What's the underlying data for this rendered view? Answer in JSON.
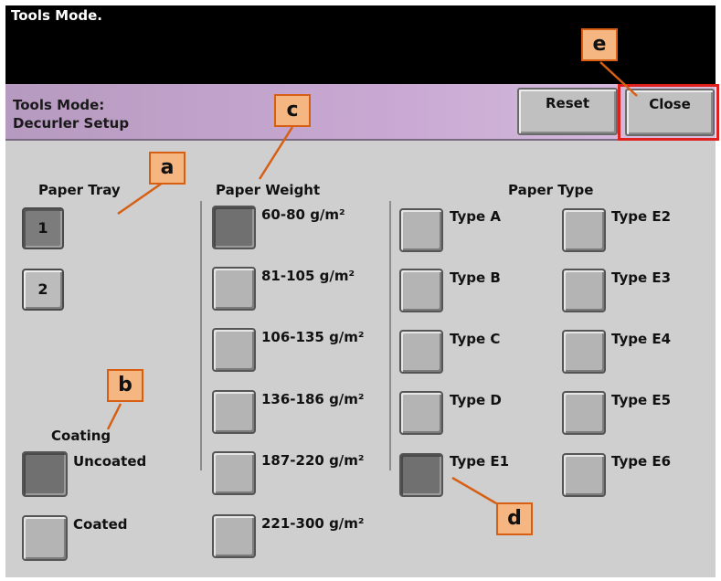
{
  "window": {
    "title": "Tools Mode."
  },
  "header": {
    "line1": "Tools Mode:",
    "line2": "Decurler Setup",
    "reset_label": "Reset",
    "close_label": "Close"
  },
  "paper_tray": {
    "heading": "Paper Tray",
    "items": [
      "1",
      "2"
    ],
    "selected": "1"
  },
  "coating": {
    "heading": "Coating",
    "options": [
      "Uncoated",
      "Coated"
    ],
    "selected": "Uncoated"
  },
  "paper_weight": {
    "heading": "Paper Weight",
    "options": [
      "60-80  g/m²",
      "81-105  g/m²",
      "106-135  g/m²",
      "136-186  g/m²",
      "187-220  g/m²",
      "221-300  g/m²"
    ],
    "selected": "60-80  g/m²"
  },
  "paper_type": {
    "heading": "Paper Type",
    "column1": [
      "Type  A",
      "Type  B",
      "Type  C",
      "Type  D",
      "Type  E1"
    ],
    "column2": [
      "Type  E2",
      "Type  E3",
      "Type  E4",
      "Type  E5",
      "Type  E6"
    ],
    "selected": "Type  E1"
  },
  "callouts": {
    "a": "a",
    "b": "b",
    "c": "c",
    "d": "d",
    "e": "e"
  },
  "colors": {
    "callout_fill": "#f6b681",
    "callout_border": "#d65f13",
    "highlight": "#e0201c",
    "title_bar": "#c9a9d3"
  }
}
